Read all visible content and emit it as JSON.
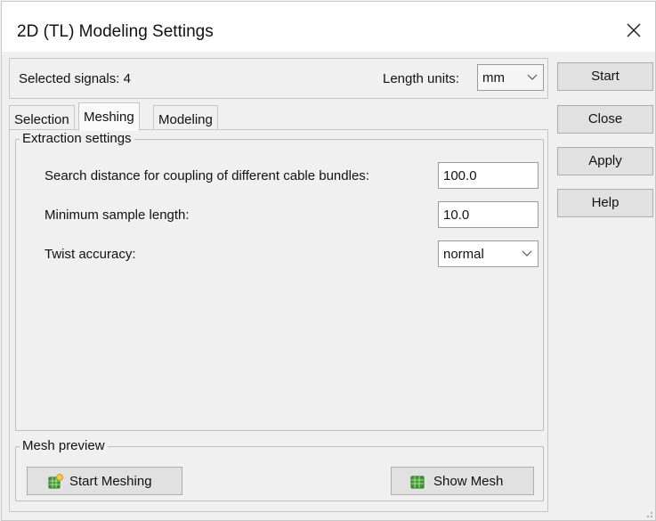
{
  "window": {
    "title": "2D (TL) Modeling Settings"
  },
  "infobar": {
    "selected_signals": "Selected signals: 4",
    "length_units_label": "Length units:",
    "length_units_value": "mm"
  },
  "tabs": [
    {
      "label": "Selection",
      "active": false
    },
    {
      "label": "Meshing",
      "active": true
    },
    {
      "label": "Modeling",
      "active": false
    }
  ],
  "extraction": {
    "title": "Extraction settings",
    "search_distance_label": "Search distance for coupling of different cable bundles:",
    "search_distance_value": "100.0",
    "min_sample_label": "Minimum sample length:",
    "min_sample_value": "10.0",
    "twist_label": "Twist accuracy:",
    "twist_value": "normal"
  },
  "mesh_preview": {
    "title": "Mesh preview",
    "start_meshing_label": "Start Meshing",
    "show_mesh_label": "Show Mesh"
  },
  "side_buttons": {
    "start": "Start",
    "close": "Close",
    "apply": "Apply",
    "help": "Help"
  },
  "colors": {
    "mesh_icon": "#3f9b2e",
    "border": "#c6c6c6",
    "button": "#e1e1e1"
  }
}
